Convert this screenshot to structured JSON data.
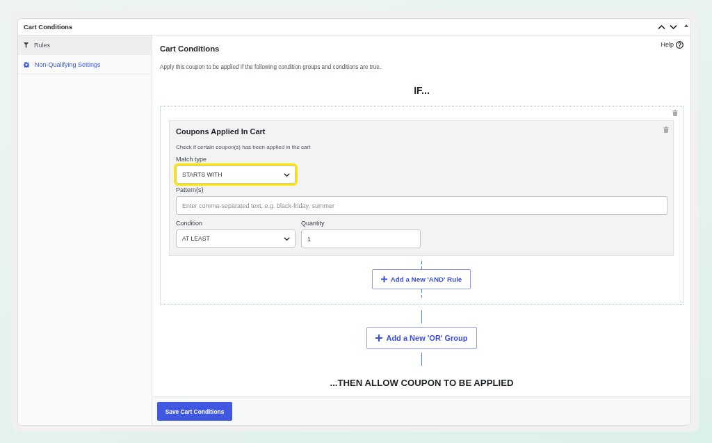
{
  "panel": {
    "title": "Cart Conditions"
  },
  "sidebar": {
    "items": [
      {
        "kind": "rules",
        "label": "Rules",
        "selected": true
      },
      {
        "kind": "settings",
        "label": "Non-Qualifying Settings",
        "selected": false
      }
    ]
  },
  "content": {
    "title": "Cart Conditions",
    "help": "Help",
    "description": "Apply this coupon to be applied if the following condition groups and conditions are true.",
    "if_label": "IF...",
    "groups": [
      {
        "conditions": [
          {
            "title": "Coupons Applied In Cart",
            "description": "Check if certain coupon(s) has been applied in the cart",
            "rows": [
              {
                "fields": [
                  {
                    "kind": "select",
                    "label": "Match type",
                    "value": "STARTS WITH",
                    "highlighted": true
                  }
                ]
              },
              {
                "fields": [
                  {
                    "kind": "text",
                    "label": "Pattern(s)",
                    "placeholder": "Enter comma-separated text, e.g. black-friday, summer"
                  }
                ]
              },
              {
                "fields": [
                  {
                    "kind": "select",
                    "label": "Condition",
                    "value": "AT LEAST",
                    "highlighted": false
                  },
                  {
                    "kind": "text",
                    "label": "Quantity",
                    "value": "1"
                  }
                ]
              }
            ]
          }
        ],
        "add_rule_button": "Add a New 'AND' Rule"
      }
    ],
    "add_group_button": "Add a New 'OR' Group",
    "then_label": "...THEN ALLOW COUPON TO BE APPLIED"
  },
  "footer": {
    "save_button": "Save Cart Conditions"
  }
}
